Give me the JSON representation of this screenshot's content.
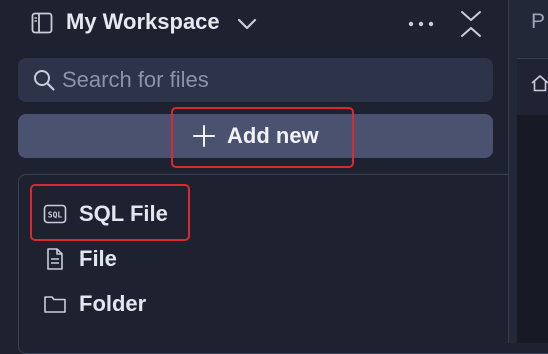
{
  "header": {
    "title": "My Workspace",
    "icons": {
      "layout": "sidebar-layout-icon",
      "dropdown": "chevron-down-icon",
      "more": "more-horizontal-icon",
      "collapse": "collapse-vertical-icon"
    }
  },
  "search": {
    "placeholder": "Search for files",
    "value": "",
    "icon": "search-icon"
  },
  "add_new": {
    "label": "Add new",
    "icon": "plus-icon"
  },
  "menu": {
    "items": [
      {
        "label": "SQL File",
        "icon": "sql-file-icon"
      },
      {
        "label": "File",
        "icon": "file-icon"
      },
      {
        "label": "Folder",
        "icon": "folder-icon"
      }
    ]
  },
  "right_panel": {
    "tab_text": "P",
    "icon": "home-icon"
  },
  "colors": {
    "background": "#1e2230",
    "input_background": "#2d3348",
    "button_background": "#4a5270",
    "text": "#e3e6ee",
    "placeholder": "#8c93a6",
    "highlight": "#d82a30"
  }
}
